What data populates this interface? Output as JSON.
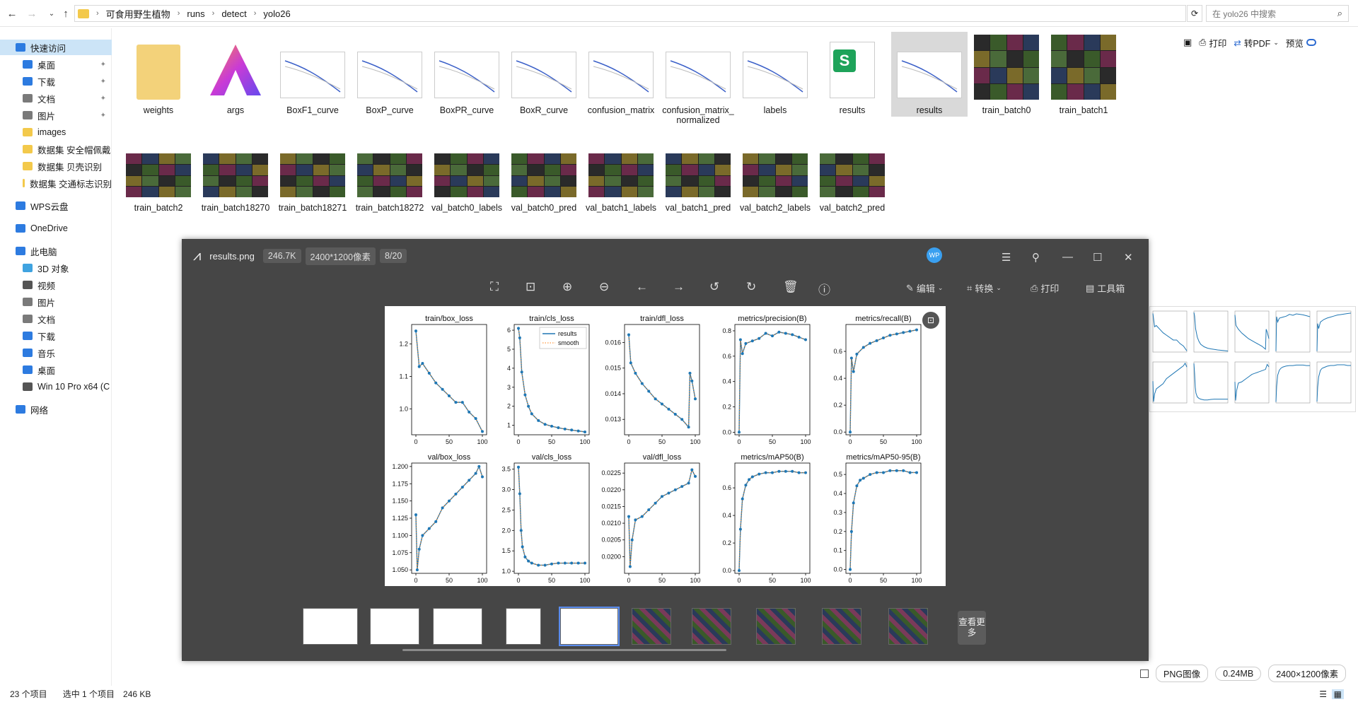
{
  "explorer": {
    "breadcrumb": [
      "可食用野生植物",
      "runs",
      "detect",
      "yolo26"
    ],
    "search_placeholder": "在 yolo26 中搜索",
    "toolbar": {
      "print": "打印",
      "to_pdf": "转PDF",
      "preview": "预览"
    },
    "sidebar": [
      {
        "label": "快速访问",
        "selected": true,
        "icon": "star-icon"
      },
      {
        "label": "桌面",
        "pinned": true,
        "icon": "desktop-icon"
      },
      {
        "label": "下载",
        "pinned": true,
        "icon": "download-icon"
      },
      {
        "label": "文档",
        "pinned": true,
        "icon": "document-icon"
      },
      {
        "label": "图片",
        "pinned": true,
        "icon": "picture-icon"
      },
      {
        "label": "images",
        "icon": "folder-icon"
      },
      {
        "label": "数据集 安全帽佩戴",
        "icon": "folder-icon"
      },
      {
        "label": "数据集 贝壳识别",
        "icon": "folder-icon"
      },
      {
        "label": "数据集 交通标志识别",
        "icon": "folder-icon"
      },
      {
        "label": "WPS云盘",
        "icon": "cloud-icon"
      },
      {
        "label": "OneDrive",
        "icon": "onedrive-icon"
      },
      {
        "label": "此电脑",
        "icon": "computer-icon"
      },
      {
        "label": "3D 对象",
        "icon": "cube-icon"
      },
      {
        "label": "视频",
        "icon": "video-icon"
      },
      {
        "label": "图片",
        "icon": "picture-icon"
      },
      {
        "label": "文档",
        "icon": "document-icon"
      },
      {
        "label": "下载",
        "icon": "download-icon"
      },
      {
        "label": "音乐",
        "icon": "music-icon"
      },
      {
        "label": "桌面",
        "icon": "desktop-icon"
      },
      {
        "label": "Win 10 Pro x64 (C",
        "icon": "drive-icon"
      },
      {
        "label": "网络",
        "icon": "network-icon"
      }
    ],
    "files": [
      {
        "name": "weights",
        "kind": "folder"
      },
      {
        "name": "args",
        "kind": "app"
      },
      {
        "name": "BoxF1_curve",
        "kind": "plot"
      },
      {
        "name": "BoxP_curve",
        "kind": "plot"
      },
      {
        "name": "BoxPR_curve",
        "kind": "plot"
      },
      {
        "name": "BoxR_curve",
        "kind": "plot"
      },
      {
        "name": "confusion_matrix",
        "kind": "matrix"
      },
      {
        "name": "confusion_matrix_normalized",
        "kind": "matrix"
      },
      {
        "name": "labels",
        "kind": "labels"
      },
      {
        "name": "results",
        "kind": "sheet"
      },
      {
        "name": "results",
        "kind": "plot",
        "selected": true
      },
      {
        "name": "train_batch0",
        "kind": "photo"
      },
      {
        "name": "train_batch1",
        "kind": "photo"
      },
      {
        "name": "train_batch2",
        "kind": "photo"
      },
      {
        "name": "train_batch18270",
        "kind": "photo"
      },
      {
        "name": "train_batch18271",
        "kind": "photo"
      },
      {
        "name": "train_batch18272",
        "kind": "photo"
      },
      {
        "name": "val_batch0_labels",
        "kind": "photo"
      },
      {
        "name": "val_batch0_pred",
        "kind": "photo"
      },
      {
        "name": "val_batch1_labels",
        "kind": "photo"
      },
      {
        "name": "val_batch1_pred",
        "kind": "photo"
      },
      {
        "name": "val_batch2_labels",
        "kind": "photo"
      },
      {
        "name": "val_batch2_pred",
        "kind": "photo"
      }
    ],
    "status": {
      "count": "23 个项目",
      "selected": "选中 1 个项目",
      "size": "246 KB"
    },
    "details": {
      "type": "PNG图像",
      "filesize": "0.24MB",
      "dims": "2400×1200像素"
    }
  },
  "viewer": {
    "filename": "results.png",
    "size": "246.7K",
    "dims": "2400*1200像素",
    "index": "8/20",
    "avatar": "WP",
    "edit": "编辑",
    "convert": "转换",
    "print": "打印",
    "tools": "工具箱",
    "more": "查看更多"
  },
  "chart_data": [
    {
      "type": "line",
      "title": "train/box_loss",
      "ylim": [
        0.92,
        1.26
      ],
      "yticks": [
        "1.2",
        "1.1",
        "1.0"
      ],
      "ytickvals": [
        1.2,
        1.1,
        1.0
      ],
      "x": [
        0,
        5,
        10,
        20,
        30,
        40,
        50,
        60,
        70,
        80,
        90,
        100
      ],
      "y": [
        1.24,
        1.13,
        1.14,
        1.11,
        1.08,
        1.06,
        1.04,
        1.02,
        1.02,
        0.99,
        0.97,
        0.93
      ]
    },
    {
      "type": "line",
      "title": "train/cls_loss",
      "ylim": [
        0.5,
        6.3
      ],
      "yticks": [
        "6",
        "5",
        "4",
        "3",
        "2",
        "1"
      ],
      "ytickvals": [
        6,
        5,
        4,
        3,
        2,
        1
      ],
      "legend": [
        "results",
        "smooth"
      ],
      "x": [
        0,
        2,
        5,
        10,
        15,
        20,
        30,
        40,
        50,
        60,
        70,
        80,
        90,
        100
      ],
      "y": [
        6.1,
        5.6,
        3.8,
        2.6,
        2.0,
        1.6,
        1.25,
        1.05,
        0.95,
        0.87,
        0.8,
        0.75,
        0.7,
        0.65
      ]
    },
    {
      "type": "line",
      "title": "train/dfl_loss",
      "ylim": [
        0.0124,
        0.0167
      ],
      "yticks": [
        "0.016",
        "0.015",
        "0.014",
        "0.013"
      ],
      "ytickvals": [
        0.016,
        0.015,
        0.014,
        0.013
      ],
      "x": [
        0,
        3,
        10,
        20,
        30,
        40,
        50,
        60,
        70,
        80,
        90,
        92,
        95,
        100
      ],
      "y": [
        0.0163,
        0.0152,
        0.0148,
        0.0144,
        0.0141,
        0.0138,
        0.0136,
        0.0134,
        0.0132,
        0.013,
        0.0127,
        0.0148,
        0.0145,
        0.0138
      ]
    },
    {
      "type": "line",
      "title": "metrics/precision(B)",
      "ylim": [
        -0.02,
        0.85
      ],
      "yticks": [
        "0.8",
        "0.6",
        "0.4",
        "0.2",
        "0.0"
      ],
      "ytickvals": [
        0.8,
        0.6,
        0.4,
        0.2,
        0.0
      ],
      "x": [
        0,
        2,
        5,
        10,
        20,
        30,
        40,
        50,
        60,
        70,
        80,
        90,
        100
      ],
      "y": [
        0.0,
        0.73,
        0.62,
        0.7,
        0.72,
        0.74,
        0.78,
        0.76,
        0.79,
        0.78,
        0.77,
        0.75,
        0.73
      ]
    },
    {
      "type": "line",
      "title": "metrics/recall(B)",
      "ylim": [
        -0.02,
        0.8
      ],
      "yticks": [
        "0.6",
        "0.4",
        "0.2",
        "0.0"
      ],
      "ytickvals": [
        0.6,
        0.4,
        0.2,
        0.0
      ],
      "x": [
        0,
        2,
        5,
        10,
        20,
        30,
        40,
        50,
        60,
        70,
        80,
        90,
        100
      ],
      "y": [
        0.0,
        0.55,
        0.45,
        0.58,
        0.63,
        0.66,
        0.68,
        0.7,
        0.72,
        0.73,
        0.74,
        0.75,
        0.76
      ]
    },
    {
      "type": "line",
      "title": "val/box_loss",
      "ylim": [
        1.045,
        1.205
      ],
      "yticks": [
        "1.200",
        "1.175",
        "1.150",
        "1.125",
        "1.100",
        "1.075",
        "1.050"
      ],
      "ytickvals": [
        1.2,
        1.175,
        1.15,
        1.125,
        1.1,
        1.075,
        1.05
      ],
      "x": [
        0,
        2,
        5,
        10,
        20,
        30,
        40,
        50,
        60,
        70,
        80,
        90,
        95,
        100
      ],
      "y": [
        1.13,
        1.05,
        1.08,
        1.1,
        1.11,
        1.12,
        1.14,
        1.15,
        1.16,
        1.17,
        1.18,
        1.19,
        1.2,
        1.185
      ]
    },
    {
      "type": "line",
      "title": "val/cls_loss",
      "ylim": [
        0.95,
        3.65
      ],
      "yticks": [
        "3.5",
        "3.0",
        "2.5",
        "2.0",
        "1.5",
        "1.0"
      ],
      "ytickvals": [
        3.5,
        3.0,
        2.5,
        2.0,
        1.5,
        1.0
      ],
      "x": [
        0,
        2,
        4,
        6,
        10,
        15,
        20,
        30,
        40,
        50,
        60,
        70,
        80,
        90,
        100
      ],
      "y": [
        3.55,
        2.9,
        2.0,
        1.6,
        1.35,
        1.25,
        1.2,
        1.15,
        1.15,
        1.18,
        1.2,
        1.2,
        1.2,
        1.2,
        1.2
      ]
    },
    {
      "type": "line",
      "title": "val/dfl_loss",
      "ylim": [
        0.0195,
        0.0228
      ],
      "yticks": [
        "0.0225",
        "0.0220",
        "0.0215",
        "0.0210",
        "0.0205",
        "0.0200"
      ],
      "ytickvals": [
        0.0225,
        0.022,
        0.0215,
        0.021,
        0.0205,
        0.02
      ],
      "x": [
        0,
        2,
        5,
        10,
        20,
        30,
        40,
        50,
        60,
        70,
        80,
        90,
        95,
        100
      ],
      "y": [
        0.0212,
        0.0197,
        0.0205,
        0.0211,
        0.0212,
        0.0214,
        0.0216,
        0.0218,
        0.0219,
        0.022,
        0.0221,
        0.0222,
        0.0226,
        0.0224
      ]
    },
    {
      "type": "line",
      "title": "metrics/mAP50(B)",
      "ylim": [
        -0.02,
        0.78
      ],
      "yticks": [
        "0.6",
        "0.4",
        "0.2",
        "0.0"
      ],
      "ytickvals": [
        0.6,
        0.4,
        0.2,
        0.0
      ],
      "x": [
        0,
        2,
        5,
        10,
        15,
        20,
        30,
        40,
        50,
        60,
        70,
        80,
        90,
        100
      ],
      "y": [
        0.0,
        0.3,
        0.52,
        0.62,
        0.66,
        0.68,
        0.7,
        0.71,
        0.71,
        0.72,
        0.72,
        0.72,
        0.71,
        0.71
      ]
    },
    {
      "type": "line",
      "title": "metrics/mAP50-95(B)",
      "ylim": [
        -0.02,
        0.56
      ],
      "yticks": [
        "0.5",
        "0.4",
        "0.3",
        "0.2",
        "0.1",
        "0.0"
      ],
      "ytickvals": [
        0.5,
        0.4,
        0.3,
        0.2,
        0.1,
        0.0
      ],
      "x": [
        0,
        2,
        5,
        10,
        15,
        20,
        30,
        40,
        50,
        60,
        70,
        80,
        90,
        100
      ],
      "y": [
        0.0,
        0.2,
        0.35,
        0.44,
        0.47,
        0.48,
        0.5,
        0.51,
        0.51,
        0.52,
        0.52,
        0.52,
        0.51,
        0.51
      ]
    }
  ],
  "xticks": [
    "0",
    "50",
    "100"
  ],
  "legend_results": "results",
  "legend_smooth": "smooth"
}
